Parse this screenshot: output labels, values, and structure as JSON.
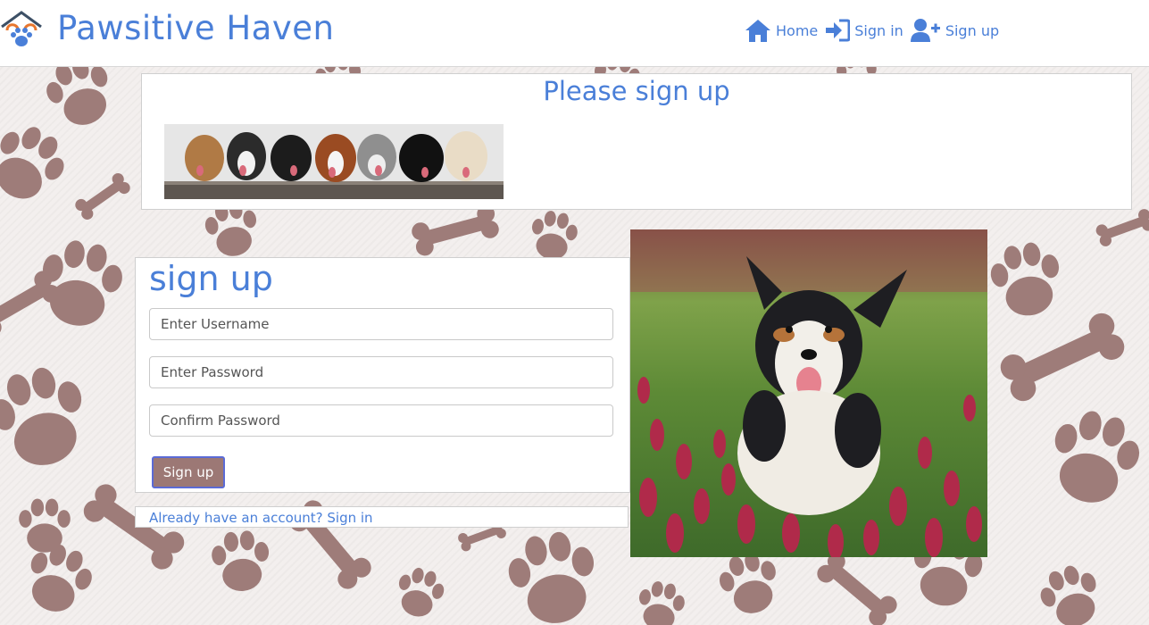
{
  "brand": {
    "name": "Pawsitive Haven",
    "logo_icon": "paw-house-logo-icon"
  },
  "nav": [
    {
      "label": "Home",
      "icon": "home-icon"
    },
    {
      "label": "Sign in",
      "icon": "sign-in-icon"
    },
    {
      "label": "Sign up",
      "icon": "user-plus-icon"
    }
  ],
  "hero": {
    "title": "Please sign up"
  },
  "form": {
    "title": "sign up",
    "username_placeholder": "Enter Username",
    "password_placeholder": "Enter Password",
    "confirm_placeholder": "Confirm Password",
    "submit_label": "Sign up"
  },
  "signin_prompt": "Already have an account? Sign in",
  "colors": {
    "accent": "#4a7fd8",
    "button": "#9c7875",
    "paw": "#9e7c79"
  }
}
